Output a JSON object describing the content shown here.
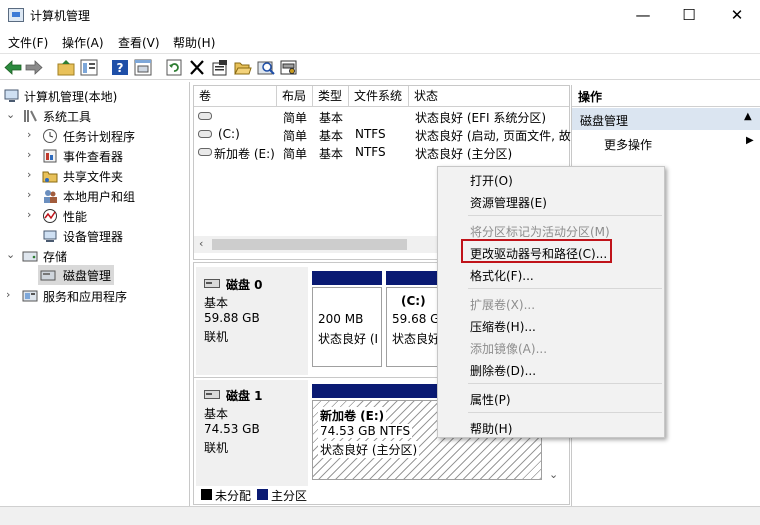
{
  "window": {
    "title": "计算机管理",
    "controls": {
      "minimize": "—",
      "maximize": "☐",
      "close": "✕"
    }
  },
  "menubar": {
    "items": [
      "文件(F)",
      "操作(A)",
      "查看(V)",
      "帮助(H)"
    ]
  },
  "toolbar": {
    "icons": [
      "back-arrow-icon",
      "forward-arrow-icon",
      "up-folder-icon",
      "properties-pane-icon",
      "help-icon",
      "console-icon",
      "refresh-icon",
      "delete-icon",
      "properties-icon",
      "open-folder-icon",
      "search-disk-icon",
      "disk-settings-icon"
    ]
  },
  "tree": {
    "root": "计算机管理(本地)",
    "system_tools": "系统工具",
    "task_scheduler": "任务计划程序",
    "event_viewer": "事件查看器",
    "shared_folders": "共享文件夹",
    "local_users": "本地用户和组",
    "performance": "性能",
    "device_manager": "设备管理器",
    "storage": "存储",
    "disk_management": "磁盘管理",
    "services_apps": "服务和应用程序"
  },
  "volume_list": {
    "columns": [
      "卷",
      "布局",
      "类型",
      "文件系统",
      "状态"
    ],
    "rows": [
      {
        "volume": "",
        "layout": "简单",
        "type": "基本",
        "fs": "",
        "status": "状态良好 (EFI 系统分区)"
      },
      {
        "volume": "(C:)",
        "layout": "简单",
        "type": "基本",
        "fs": "NTFS",
        "status": "状态良好 (启动, 页面文件, 故"
      },
      {
        "volume": "新加卷 (E:)",
        "layout": "简单",
        "type": "基本",
        "fs": "NTFS",
        "status": "状态良好 (主分区)"
      }
    ]
  },
  "disks": [
    {
      "name": "磁盘 0",
      "kind": "基本",
      "size": "59.88 GB",
      "state": "联机",
      "partitions": [
        {
          "label": "",
          "size": "200 MB",
          "status": "状态良好 (I"
        },
        {
          "label": "(C:)",
          "size": "59.68 G",
          "status": "状态良好"
        }
      ]
    },
    {
      "name": "磁盘 1",
      "kind": "基本",
      "size": "74.53 GB",
      "state": "联机",
      "partitions": [
        {
          "label": "新加卷  (E:)",
          "size": "74.53 GB NTFS",
          "status": "状态良好 (主分区)"
        }
      ]
    }
  ],
  "legend": {
    "unallocated": "未分配",
    "primary": "主分区",
    "colors": {
      "unallocated": "#000000",
      "primary": "#0a1a73"
    }
  },
  "actions": {
    "header": "操作",
    "section": "磁盘管理",
    "more": "更多操作"
  },
  "context_menu": {
    "items": [
      {
        "label": "打开(O)",
        "enabled": true
      },
      {
        "label": "资源管理器(E)",
        "enabled": true
      },
      {
        "label": "将分区标记为活动分区(M)",
        "enabled": false
      },
      {
        "label": "更改驱动器号和路径(C)...",
        "enabled": true
      },
      {
        "label": "格式化(F)...",
        "enabled": true
      },
      {
        "label": "扩展卷(X)...",
        "enabled": false
      },
      {
        "label": "压缩卷(H)...",
        "enabled": true
      },
      {
        "label": "添加镜像(A)...",
        "enabled": false
      },
      {
        "label": "删除卷(D)...",
        "enabled": true
      },
      {
        "label": "属性(P)",
        "enabled": true
      },
      {
        "label": "帮助(H)",
        "enabled": true
      }
    ],
    "highlight_color": "#c0131a"
  }
}
